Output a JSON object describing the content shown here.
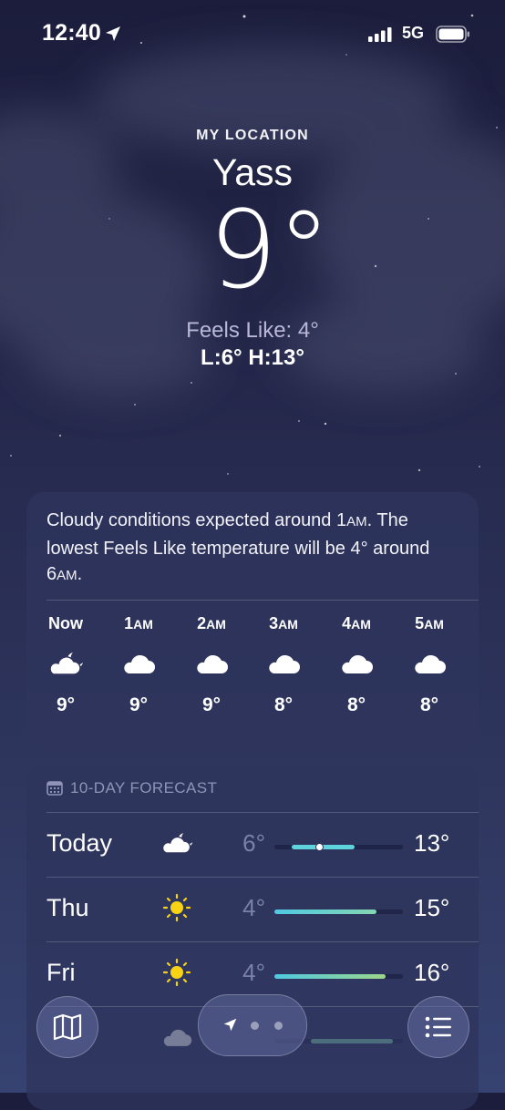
{
  "status_bar": {
    "time": "12:40",
    "network": "5G"
  },
  "header": {
    "location_label": "MY LOCATION",
    "city": "Yass",
    "temperature": "9°",
    "feels_like": "Feels Like: 4°",
    "low_high": "L:6° H:13°"
  },
  "hourly": {
    "summary": {
      "part1": "Cloudy conditions expected around 1",
      "part1_suffix": "AM",
      "part2": ". The lowest Feels Like temperature will be 4° around 6",
      "part2_suffix": "AM",
      "end": "."
    },
    "hours": [
      {
        "label": "Now",
        "suffix": "",
        "icon": "partly-cloudy-night-icon",
        "temp": "9°"
      },
      {
        "label": "1",
        "suffix": "AM",
        "icon": "cloud-icon",
        "temp": "9°"
      },
      {
        "label": "2",
        "suffix": "AM",
        "icon": "cloud-icon",
        "temp": "9°"
      },
      {
        "label": "3",
        "suffix": "AM",
        "icon": "cloud-icon",
        "temp": "8°"
      },
      {
        "label": "4",
        "suffix": "AM",
        "icon": "cloud-icon",
        "temp": "8°"
      },
      {
        "label": "5",
        "suffix": "AM",
        "icon": "cloud-icon",
        "temp": "8°"
      }
    ]
  },
  "forecast": {
    "title": "10-DAY FORECAST",
    "days": [
      {
        "day": "Today",
        "icon": "partly-cloudy-night-icon",
        "low": "6°",
        "high": "13°",
        "current_level": 0.35
      },
      {
        "day": "Thu",
        "icon": "sun-icon",
        "low": "4°",
        "high": "15°"
      },
      {
        "day": "Fri",
        "icon": "sun-icon",
        "low": "4°",
        "high": "16°"
      }
    ]
  },
  "colors": {
    "bar_cool": "#5fd3dc",
    "bar_warm": "#9cd78a",
    "sun": "#f7d313"
  }
}
